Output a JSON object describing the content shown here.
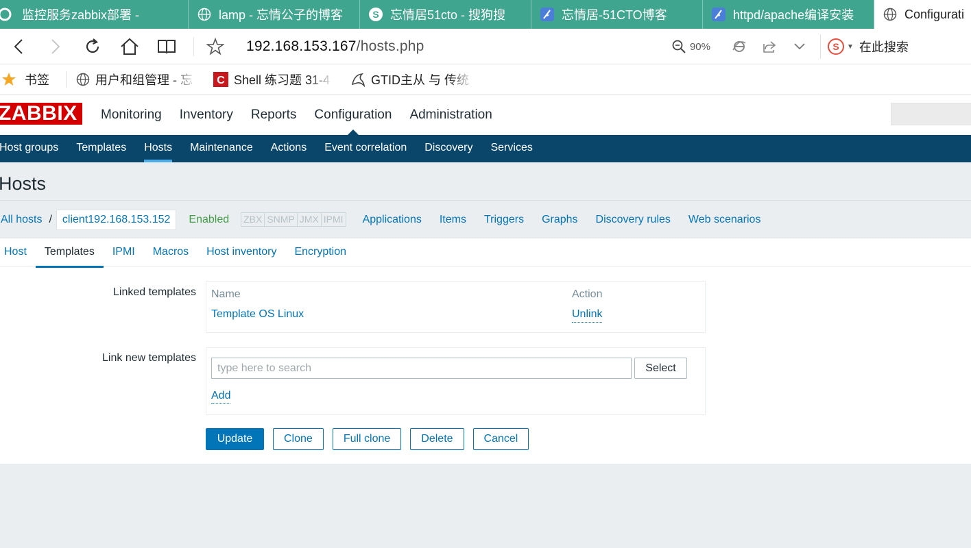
{
  "browser": {
    "tabs": [
      {
        "label": "监控服务zabbix部署 -",
        "icon": "qq-browser-icon"
      },
      {
        "label": "lamp - 忘情公子的博客",
        "icon": "globe-icon"
      },
      {
        "label": "忘情居51cto - 搜狗搜",
        "icon": "sogou-icon"
      },
      {
        "label": "忘情居-51CTO博客",
        "icon": "feather-icon"
      },
      {
        "label": "httpd/apache编译安装",
        "icon": "feather-icon"
      },
      {
        "label": "Configurati",
        "icon": "globe-icon",
        "active": true
      }
    ],
    "url_host": "192.168.153.167",
    "url_path": "/hosts.php",
    "zoom": "90%",
    "search_placeholder": "在此搜索",
    "bookmarks_label": "书签",
    "bookmarks": [
      {
        "label": "用户和组管理 - 忘",
        "icon": "globe-icon"
      },
      {
        "label": "Shell 练习题 31-4",
        "icon": "csdn-icon"
      },
      {
        "label": "GTID主从 与 传统",
        "icon": "dolphin-icon"
      }
    ]
  },
  "zabbix": {
    "logo": "ZABBIX",
    "main_nav": [
      "Monitoring",
      "Inventory",
      "Reports",
      "Configuration",
      "Administration"
    ],
    "sub_nav": [
      "Host groups",
      "Templates",
      "Hosts",
      "Maintenance",
      "Actions",
      "Event correlation",
      "Discovery",
      "Services"
    ],
    "page_title": "Hosts",
    "breadcrumb": {
      "all_hosts": "All hosts",
      "separator": "/",
      "current_host": "client192.168.153.152",
      "status": "Enabled",
      "availability_tags": [
        "ZBX",
        "SNMP",
        "JMX",
        "IPMI"
      ],
      "links": [
        "Applications",
        "Items",
        "Triggers",
        "Graphs",
        "Discovery rules",
        "Web scenarios"
      ]
    },
    "form_tabs": [
      "Host",
      "Templates",
      "IPMI",
      "Macros",
      "Host inventory",
      "Encryption"
    ],
    "linked_templates": {
      "label": "Linked templates",
      "col_name": "Name",
      "col_action": "Action",
      "rows": [
        {
          "name": "Template OS Linux",
          "action": "Unlink"
        }
      ]
    },
    "link_new": {
      "label": "Link new templates",
      "placeholder": "type here to search",
      "select_label": "Select",
      "add_label": "Add"
    },
    "buttons": {
      "update": "Update",
      "clone": "Clone",
      "full_clone": "Full clone",
      "delete": "Delete",
      "cancel": "Cancel"
    },
    "colors": {
      "logo_red": "#d40000",
      "nav_dark_blue": "#0a466a",
      "link_blue": "#0275b8",
      "enabled_green": "#429e47"
    }
  }
}
